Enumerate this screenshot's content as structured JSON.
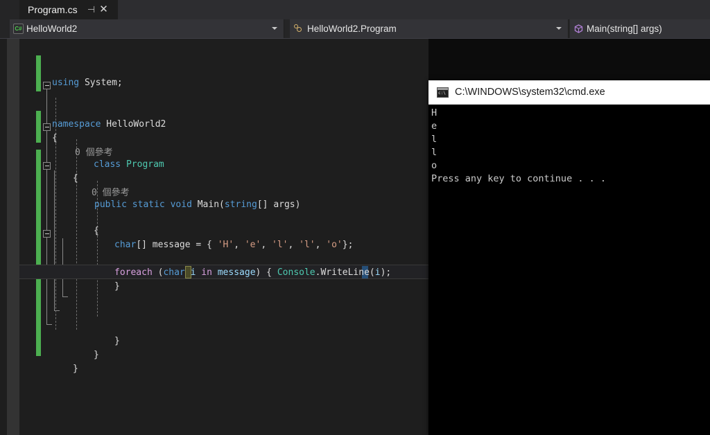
{
  "tab": {
    "title": "Program.cs",
    "pin_icon": "pin-icon",
    "close_icon": "close-icon"
  },
  "navbar": {
    "project": {
      "icon": "csharp-file-icon",
      "label": "HelloWorld2"
    },
    "class": {
      "icon": "class-icon",
      "label": "HelloWorld2.Program"
    },
    "member": {
      "icon": "method-icon",
      "label": "Main(string[] args)"
    }
  },
  "editor": {
    "lightbulb_icon": "lightbulb-icon",
    "codelens_class": "0 個參考",
    "codelens_method": "0 個參考",
    "lines": {
      "using_kw": "using",
      "using_ns": " System;",
      "namespace_kw": "namespace",
      "namespace_name": " HelloWorld2",
      "brace_open_1": "{",
      "class_kw": "class",
      "class_name": " Program",
      "brace_open_2": "{",
      "public_kw": "public",
      "static_kw": " static",
      "void_kw": " void",
      "main_name": " Main",
      "main_paren_open": "(",
      "string_kw": "string",
      "main_args": "[] args",
      "main_paren_close": ")",
      "brace_open_3": "{",
      "char_kw": "char",
      "message_decl": "[] message = { ",
      "ch_h": "'H'",
      "sep1": ", ",
      "ch_e": "'e'",
      "sep2": ", ",
      "ch_l1": "'l'",
      "sep3": ", ",
      "ch_l2": "'l'",
      "sep4": ", ",
      "ch_o": "'o'",
      "message_end": "};",
      "foreach_kw": "foreach",
      "foreach_paren": " (",
      "foreach_char": "char",
      "foreach_var": "i",
      "foreach_in": " in",
      "foreach_coll": " message",
      "foreach_close": ") { ",
      "console_obj": "Console",
      "console_dot": ".",
      "console_method": "WriteLine",
      "console_paren": "(",
      "console_arg": "i",
      "console_end": ");",
      "brace_close_1": "}",
      "brace_close_2": "}",
      "brace_close_3": "}",
      "brace_close_4": "}"
    }
  },
  "console": {
    "title": "C:\\WINDOWS\\system32\\cmd.exe",
    "icon": "cmd-icon",
    "output": [
      "H",
      "e",
      "l",
      "l",
      "o",
      "Press any key to continue . . ."
    ]
  },
  "colors": {
    "accent_green": "#4caf50",
    "keyword_blue": "#569cd6",
    "keyword_purple": "#d8a0df",
    "type_teal": "#4ec9b0",
    "string_orange": "#d69d85",
    "selection_blue": "#264f78",
    "reference_olive": "#4a4a28",
    "editor_bg": "#1e1e1e",
    "console_bg": "#000000"
  }
}
